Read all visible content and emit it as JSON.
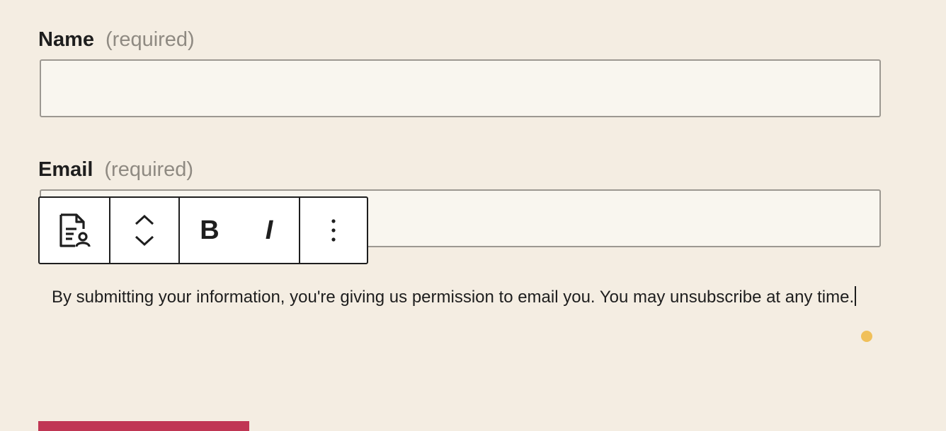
{
  "form": {
    "name_field": {
      "label": "Name",
      "required_text": "(required)",
      "value": "",
      "placeholder": ""
    },
    "email_field": {
      "label": "Email",
      "required_text": "(required)",
      "value": "",
      "placeholder": ""
    },
    "consent_text": "By submitting your information, you're giving us permission to email you. You may unsubscribe at any time.",
    "submit_button_color": "#c03654"
  },
  "block_toolbar": {
    "block_type_icon": "document-user-icon",
    "move_up_icon": "chevron-up-icon",
    "move_down_icon": "chevron-down-icon",
    "bold_label": "B",
    "italic_label": "I",
    "more_icon": "more-vertical-icon"
  },
  "colors": {
    "background": "#f4ede2",
    "input_background": "#f9f6ef",
    "accent_dot": "#f0c05a",
    "submit": "#c03654"
  }
}
